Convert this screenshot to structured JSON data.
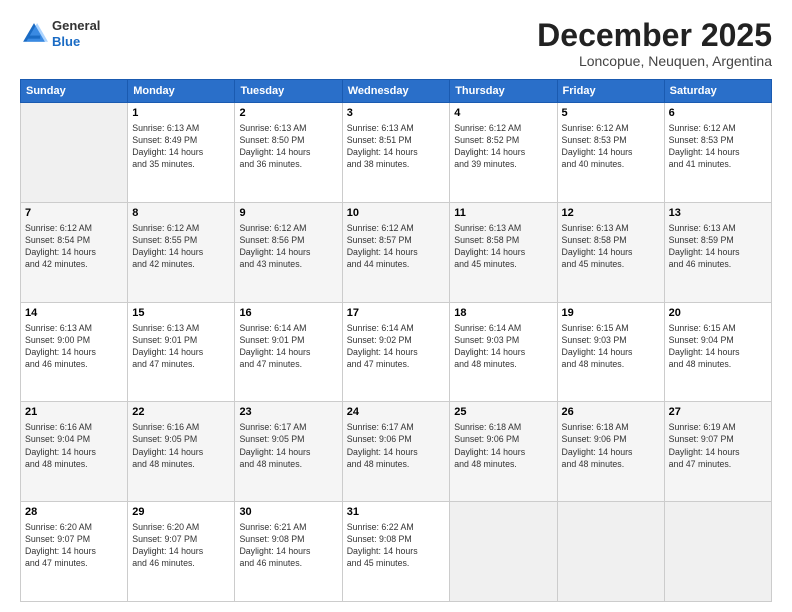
{
  "header": {
    "logo_line1": "General",
    "logo_line2": "Blue",
    "month": "December 2025",
    "location": "Loncopue, Neuquen, Argentina"
  },
  "weekdays": [
    "Sunday",
    "Monday",
    "Tuesday",
    "Wednesday",
    "Thursday",
    "Friday",
    "Saturday"
  ],
  "weeks": [
    [
      {
        "day": "",
        "info": ""
      },
      {
        "day": "1",
        "info": "Sunrise: 6:13 AM\nSunset: 8:49 PM\nDaylight: 14 hours\nand 35 minutes."
      },
      {
        "day": "2",
        "info": "Sunrise: 6:13 AM\nSunset: 8:50 PM\nDaylight: 14 hours\nand 36 minutes."
      },
      {
        "day": "3",
        "info": "Sunrise: 6:13 AM\nSunset: 8:51 PM\nDaylight: 14 hours\nand 38 minutes."
      },
      {
        "day": "4",
        "info": "Sunrise: 6:12 AM\nSunset: 8:52 PM\nDaylight: 14 hours\nand 39 minutes."
      },
      {
        "day": "5",
        "info": "Sunrise: 6:12 AM\nSunset: 8:53 PM\nDaylight: 14 hours\nand 40 minutes."
      },
      {
        "day": "6",
        "info": "Sunrise: 6:12 AM\nSunset: 8:53 PM\nDaylight: 14 hours\nand 41 minutes."
      }
    ],
    [
      {
        "day": "7",
        "info": "Sunrise: 6:12 AM\nSunset: 8:54 PM\nDaylight: 14 hours\nand 42 minutes."
      },
      {
        "day": "8",
        "info": "Sunrise: 6:12 AM\nSunset: 8:55 PM\nDaylight: 14 hours\nand 42 minutes."
      },
      {
        "day": "9",
        "info": "Sunrise: 6:12 AM\nSunset: 8:56 PM\nDaylight: 14 hours\nand 43 minutes."
      },
      {
        "day": "10",
        "info": "Sunrise: 6:12 AM\nSunset: 8:57 PM\nDaylight: 14 hours\nand 44 minutes."
      },
      {
        "day": "11",
        "info": "Sunrise: 6:13 AM\nSunset: 8:58 PM\nDaylight: 14 hours\nand 45 minutes."
      },
      {
        "day": "12",
        "info": "Sunrise: 6:13 AM\nSunset: 8:58 PM\nDaylight: 14 hours\nand 45 minutes."
      },
      {
        "day": "13",
        "info": "Sunrise: 6:13 AM\nSunset: 8:59 PM\nDaylight: 14 hours\nand 46 minutes."
      }
    ],
    [
      {
        "day": "14",
        "info": "Sunrise: 6:13 AM\nSunset: 9:00 PM\nDaylight: 14 hours\nand 46 minutes."
      },
      {
        "day": "15",
        "info": "Sunrise: 6:13 AM\nSunset: 9:01 PM\nDaylight: 14 hours\nand 47 minutes."
      },
      {
        "day": "16",
        "info": "Sunrise: 6:14 AM\nSunset: 9:01 PM\nDaylight: 14 hours\nand 47 minutes."
      },
      {
        "day": "17",
        "info": "Sunrise: 6:14 AM\nSunset: 9:02 PM\nDaylight: 14 hours\nand 47 minutes."
      },
      {
        "day": "18",
        "info": "Sunrise: 6:14 AM\nSunset: 9:03 PM\nDaylight: 14 hours\nand 48 minutes."
      },
      {
        "day": "19",
        "info": "Sunrise: 6:15 AM\nSunset: 9:03 PM\nDaylight: 14 hours\nand 48 minutes."
      },
      {
        "day": "20",
        "info": "Sunrise: 6:15 AM\nSunset: 9:04 PM\nDaylight: 14 hours\nand 48 minutes."
      }
    ],
    [
      {
        "day": "21",
        "info": "Sunrise: 6:16 AM\nSunset: 9:04 PM\nDaylight: 14 hours\nand 48 minutes."
      },
      {
        "day": "22",
        "info": "Sunrise: 6:16 AM\nSunset: 9:05 PM\nDaylight: 14 hours\nand 48 minutes."
      },
      {
        "day": "23",
        "info": "Sunrise: 6:17 AM\nSunset: 9:05 PM\nDaylight: 14 hours\nand 48 minutes."
      },
      {
        "day": "24",
        "info": "Sunrise: 6:17 AM\nSunset: 9:06 PM\nDaylight: 14 hours\nand 48 minutes."
      },
      {
        "day": "25",
        "info": "Sunrise: 6:18 AM\nSunset: 9:06 PM\nDaylight: 14 hours\nand 48 minutes."
      },
      {
        "day": "26",
        "info": "Sunrise: 6:18 AM\nSunset: 9:06 PM\nDaylight: 14 hours\nand 48 minutes."
      },
      {
        "day": "27",
        "info": "Sunrise: 6:19 AM\nSunset: 9:07 PM\nDaylight: 14 hours\nand 47 minutes."
      }
    ],
    [
      {
        "day": "28",
        "info": "Sunrise: 6:20 AM\nSunset: 9:07 PM\nDaylight: 14 hours\nand 47 minutes."
      },
      {
        "day": "29",
        "info": "Sunrise: 6:20 AM\nSunset: 9:07 PM\nDaylight: 14 hours\nand 46 minutes."
      },
      {
        "day": "30",
        "info": "Sunrise: 6:21 AM\nSunset: 9:08 PM\nDaylight: 14 hours\nand 46 minutes."
      },
      {
        "day": "31",
        "info": "Sunrise: 6:22 AM\nSunset: 9:08 PM\nDaylight: 14 hours\nand 45 minutes."
      },
      {
        "day": "",
        "info": ""
      },
      {
        "day": "",
        "info": ""
      },
      {
        "day": "",
        "info": ""
      }
    ]
  ]
}
